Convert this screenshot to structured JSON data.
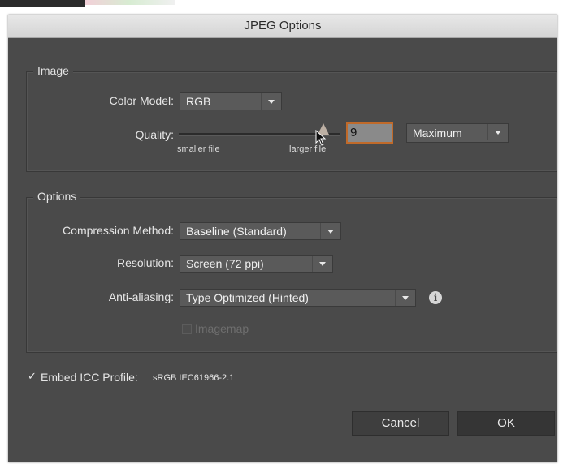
{
  "dialog": {
    "title": "JPEG Options"
  },
  "image_group": {
    "legend": "Image",
    "color_model_label": "Color Model:",
    "color_model_value": "RGB",
    "quality_label": "Quality:",
    "quality_value": "9",
    "quality_preset": "Maximum",
    "slider_min_label": "smaller file",
    "slider_max_label": "larger file",
    "slider_level": 0.9
  },
  "options_group": {
    "legend": "Options",
    "compression_label": "Compression Method:",
    "compression_value": "Baseline (Standard)",
    "resolution_label": "Resolution:",
    "resolution_value": "Screen (72 ppi)",
    "antialiasing_label": "Anti-aliasing:",
    "antialiasing_value": "Type Optimized (Hinted)",
    "imagemap_label": "Imagemap",
    "imagemap_checked": false
  },
  "embed": {
    "label": "Embed ICC Profile:",
    "value": "sRGB IEC61966-2.1",
    "checked": true
  },
  "buttons": {
    "cancel": "Cancel",
    "ok": "OK"
  },
  "colors": {
    "dialog_bg": "#4a4a4a",
    "focus_ring": "#c06a2a"
  },
  "icons": {
    "info": "info-icon",
    "dropdown": "chevron-down-icon",
    "check": "checkmark-icon"
  }
}
